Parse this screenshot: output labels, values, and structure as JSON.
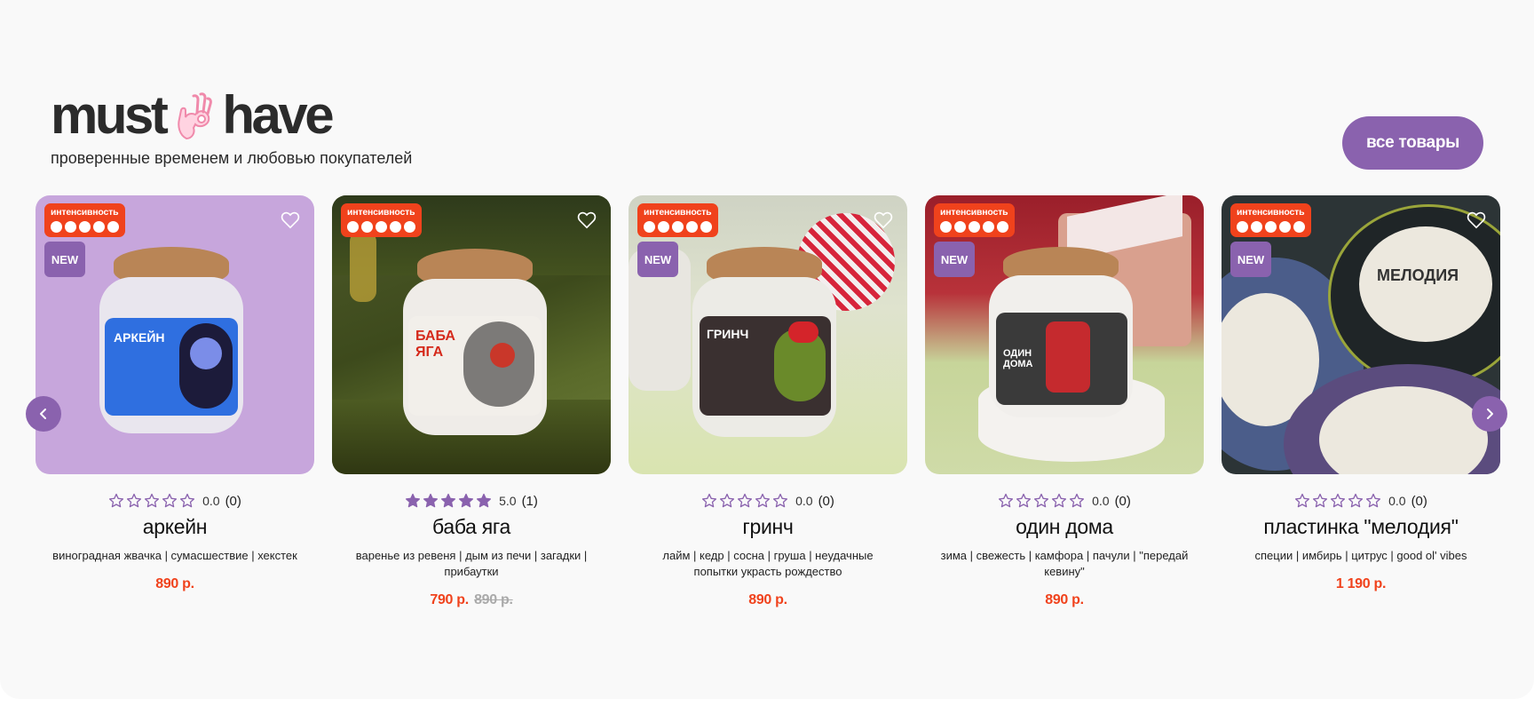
{
  "header": {
    "title_left": "must",
    "title_right": "have",
    "subtitle": "проверенные временем и любовью покупателей",
    "all_button": "все товары"
  },
  "badges": {
    "intensity": "интенсивность",
    "new": "NEW"
  },
  "colors": {
    "accent": "#8a62ae",
    "price": "#f0421c",
    "badge": "#f0421c"
  },
  "products": [
    {
      "name": "аркейн",
      "rating": "0.0",
      "rating_value": 0,
      "reviews": "(0)",
      "tags": "виноградная жвачка | сумасшествие | хекстек",
      "price": "890 р.",
      "old_price": "",
      "is_new": true,
      "label_text": "АРКЕЙН"
    },
    {
      "name": "баба яга",
      "rating": "5.0",
      "rating_value": 5,
      "reviews": "(1)",
      "tags": "варенье из ревеня | дым из печи | загадки | прибаутки",
      "price": "790 р.",
      "old_price": "890 р.",
      "is_new": false,
      "label_text": "БАБА ЯГА"
    },
    {
      "name": "гринч",
      "rating": "0.0",
      "rating_value": 0,
      "reviews": "(0)",
      "tags": "лайм | кедр | сосна | груша | неудачные попытки украсть рождество",
      "price": "890 р.",
      "old_price": "",
      "is_new": true,
      "label_text": "ГРИНЧ"
    },
    {
      "name": "один дома",
      "rating": "0.0",
      "rating_value": 0,
      "reviews": "(0)",
      "tags": "зима | свежесть | камфора | пачули | \"передай кевину\"",
      "price": "890 р.",
      "old_price": "",
      "is_new": true,
      "label_text": "ОДИН ДОМА"
    },
    {
      "name": "пластинка \"мелодия\"",
      "rating": "0.0",
      "rating_value": 0,
      "reviews": "(0)",
      "tags": "специи | имбирь | цитрус | good ol' vibes",
      "price": "1 190 р.",
      "old_price": "",
      "is_new": true,
      "label_text": "МЕЛОДИЯ"
    }
  ]
}
